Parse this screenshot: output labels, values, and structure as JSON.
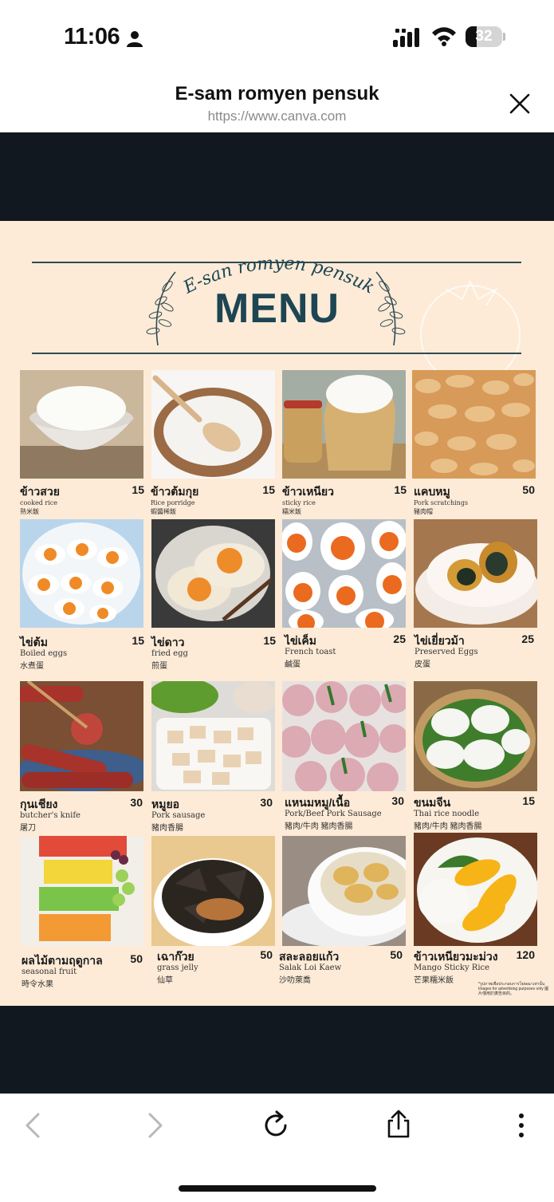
{
  "status_bar": {
    "time": "11:06",
    "battery": "32",
    "icons": [
      "person-icon",
      "signal-icon",
      "wifi-icon",
      "battery-icon"
    ]
  },
  "header": {
    "title": "E-sam romyen pensuk",
    "url": "https://www.canva.com",
    "close_icon": "close-icon"
  },
  "menu": {
    "brand": "E-san romyen pensuk",
    "heading": "MENU",
    "colors": {
      "background": "#fdebd7",
      "heading": "#1d4553",
      "rule": "#2f4a52"
    },
    "items": [
      {
        "thai": "ข้าวสวย",
        "en": "cooked rice",
        "cn": "熟米飯",
        "price": "15"
      },
      {
        "thai": "ข้าวต้มกุย",
        "en": "Rice porridge",
        "cn": "蝦醬稀飯",
        "price": "15"
      },
      {
        "thai": "ข้าวเหนียว",
        "en": "sticky rice",
        "cn": "糯米飯",
        "price": "15"
      },
      {
        "thai": "แคบหมู",
        "en": "Pork scratchings",
        "cn": "豬肉帽",
        "price": "50"
      },
      {
        "thai": "ไข่ต้ม",
        "en": "Boiled eggs",
        "cn": "水煮蛋",
        "price": "15"
      },
      {
        "thai": "ไข่ดาว",
        "en": "fried egg",
        "cn": "煎蛋",
        "price": "15"
      },
      {
        "thai": "ไข่เค็ม",
        "en": "French toast",
        "cn": "鹹蛋",
        "price": "25"
      },
      {
        "thai": "ไข่เยี่ยวม้า",
        "en": "Preserved Eggs",
        "cn": "皮蛋",
        "price": "25"
      },
      {
        "thai": "กุนเชียง",
        "en": "butcher's knife",
        "cn": "屠刀",
        "price": "30"
      },
      {
        "thai": "หมูยอ",
        "en": "Pork sausage",
        "cn": "豬肉香腸",
        "price": "30"
      },
      {
        "thai": "แหนมหมู/เนื้อ",
        "en": "Pork/Beef Pork Sausage",
        "cn": "豬肉/牛肉 豬肉香腸",
        "price": "30"
      },
      {
        "thai": "ขนมจีน",
        "en": "Thai rice noodle",
        "cn": "豬肉/牛肉 豬肉香腸",
        "price": "15"
      },
      {
        "thai": "ผลไม้ตามฤดูกาล",
        "en": "seasonal fruit",
        "cn": "時令水果",
        "price": "50"
      },
      {
        "thai": "เฉาก๊วย",
        "en": "grass jelly",
        "cn": "仙草",
        "price": "50"
      },
      {
        "thai": "สละลอยแก้ว",
        "en": "Salak Loi Kaew",
        "cn": "沙叻萊喬",
        "price": "50"
      },
      {
        "thai": "ข้าวเหนียวมะม่วง",
        "en": "Mango Sticky Rice",
        "cn": "芒果糯米飯",
        "price": "120"
      }
    ],
    "disclaimer": "*รูปภาพเพื่อประกอบการโฆษณาเท่านั้น Images for advertising purposes only 圖片僅用於廣告目的。"
  },
  "toolbar": {
    "icons": [
      "back-icon",
      "forward-icon",
      "reload-icon",
      "share-icon",
      "more-icon"
    ]
  }
}
